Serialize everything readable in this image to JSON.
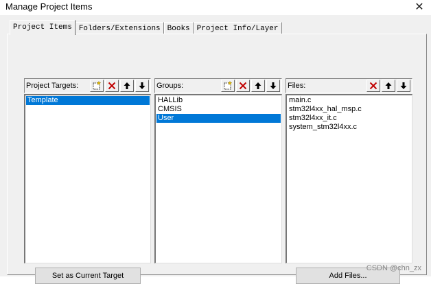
{
  "window": {
    "title": "Manage Project Items",
    "close_glyph": "✕"
  },
  "tabs": [
    {
      "label": "Project Items",
      "active": true
    },
    {
      "label": "Folders/Extensions",
      "active": false
    },
    {
      "label": "Books",
      "active": false
    },
    {
      "label": "Project Info/Layer",
      "active": false
    }
  ],
  "targets": {
    "label": "Project Targets:",
    "items": [
      {
        "text": "Template",
        "selected": true
      }
    ],
    "set_current_button": "Set as Current Target"
  },
  "groups": {
    "label": "Groups:",
    "items": [
      {
        "text": "HALLib",
        "selected": false
      },
      {
        "text": "CMSIS",
        "selected": false
      },
      {
        "text": "User",
        "selected": true
      }
    ]
  },
  "files": {
    "label": "Files:",
    "items": [
      {
        "text": "main.c",
        "selected": false
      },
      {
        "text": "stm32l4xx_hal_msp.c",
        "selected": false
      },
      {
        "text": "stm32l4xx_it.c",
        "selected": false
      },
      {
        "text": "system_stm32l4xx.c",
        "selected": false
      }
    ],
    "add_files_button": "Add Files..."
  },
  "watermark": "CSDN @chn_zx",
  "colors": {
    "selection": "#0078d7",
    "delete_icon": "#c00000"
  },
  "icons": [
    "new-item-icon",
    "delete-icon",
    "move-up-icon",
    "move-down-icon",
    "close-icon"
  ]
}
